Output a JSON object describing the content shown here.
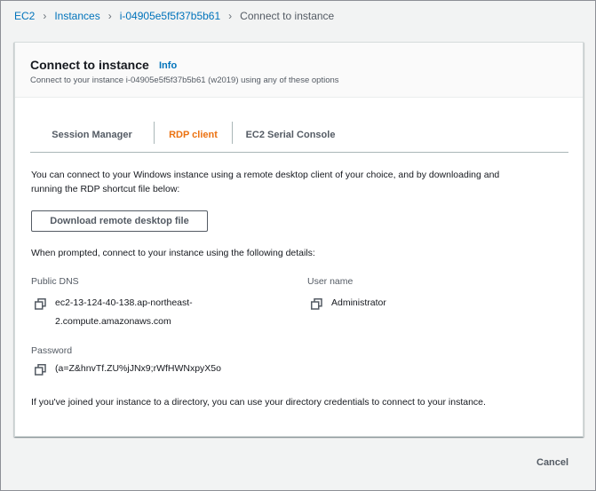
{
  "breadcrumb": {
    "items": [
      "EC2",
      "Instances",
      "i-04905e5f5f37b5b61"
    ],
    "current": "Connect to instance"
  },
  "header": {
    "title": "Connect to instance",
    "info": "Info",
    "description": "Connect to your instance i-04905e5f5f37b5b61 (w2019) using any of these options"
  },
  "tabs": {
    "items": [
      "Session Manager",
      "RDP client",
      "EC2 Serial Console"
    ],
    "active": "RDP client"
  },
  "rdp": {
    "intro_line1": "You can connect to your Windows instance using a remote desktop client of your choice, and by downloading and",
    "intro_line2": "running the RDP shortcut file below:",
    "download_button": "Download remote desktop file",
    "prompt": "When prompted, connect to your instance using the following details:",
    "public_dns_label": "Public DNS",
    "public_dns_line1": "ec2-13-124-40-138.ap-northeast-",
    "public_dns_line2": "2.compute.amazonaws.com",
    "username_label": "User name",
    "username_value": "Administrator",
    "password_label": "Password",
    "password_value": "(a=Z&hnvTf.ZU%jJNx9;rWfHWNxpyX5o",
    "directory_note": "If you've joined your instance to a directory, you can use your directory credentials to connect to your instance."
  },
  "footer": {
    "cancel": "Cancel"
  },
  "colors": {
    "link": "#0073bb",
    "active_tab": "#ec7211",
    "text": "#16191f",
    "muted": "#545b64"
  },
  "icons": {
    "copy": "copy-icon",
    "separator": "chevron-right-icon"
  }
}
